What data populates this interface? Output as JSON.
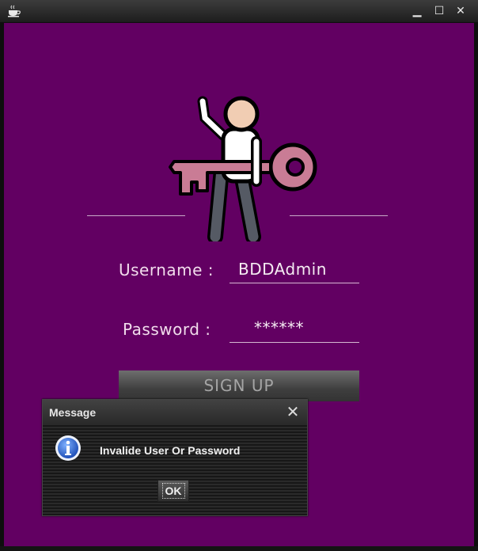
{
  "window": {
    "controls": {
      "minimize": "▁",
      "maximize": "☐",
      "close": "✕"
    }
  },
  "login": {
    "username_label": "Username  :",
    "username_value": "BDDAdmin",
    "password_label": "Password  :",
    "password_value": "******",
    "signup_label": "SIGN UP"
  },
  "dialog": {
    "title": "Message",
    "close": "✕",
    "message": "Invalide User Or Password",
    "ok_label": "OK"
  },
  "colors": {
    "background": "#620062",
    "key": "#c97c95"
  },
  "icons": [
    "coffee-cup-icon",
    "login-key-person-icon",
    "info-icon"
  ]
}
